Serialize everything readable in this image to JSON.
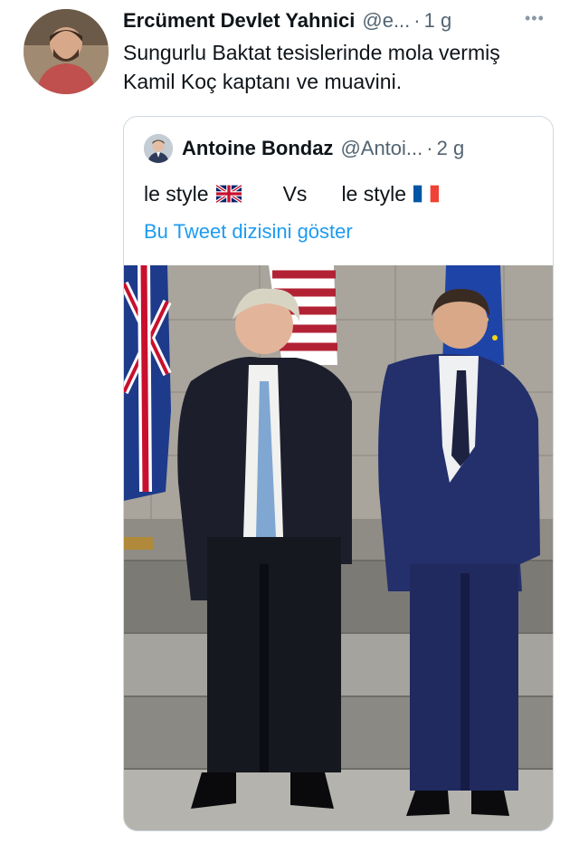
{
  "tweet": {
    "author_name": "Ercüment Devlet Yahnici",
    "author_handle": "@e...",
    "separator": "·",
    "timestamp": "1 g",
    "more_icon": "more-horizontal-icon",
    "text": "Sungurlu Baktat tesislerinde mola vermiş Kamil Koç kaptanı ve muavini."
  },
  "quote": {
    "author_name": "Antoine Bondaz",
    "author_handle": "@Antoi...",
    "separator": "·",
    "timestamp": "2 g",
    "text_part1": "le style",
    "flag1": "uk-flag-icon",
    "vs": "Vs",
    "text_part2": "le style",
    "flag2": "france-flag-icon",
    "thread_link": "Bu Tweet dizisini göster"
  },
  "colors": {
    "link": "#1d9bf0",
    "secondary_text": "#536471",
    "border": "#cfd9de"
  }
}
